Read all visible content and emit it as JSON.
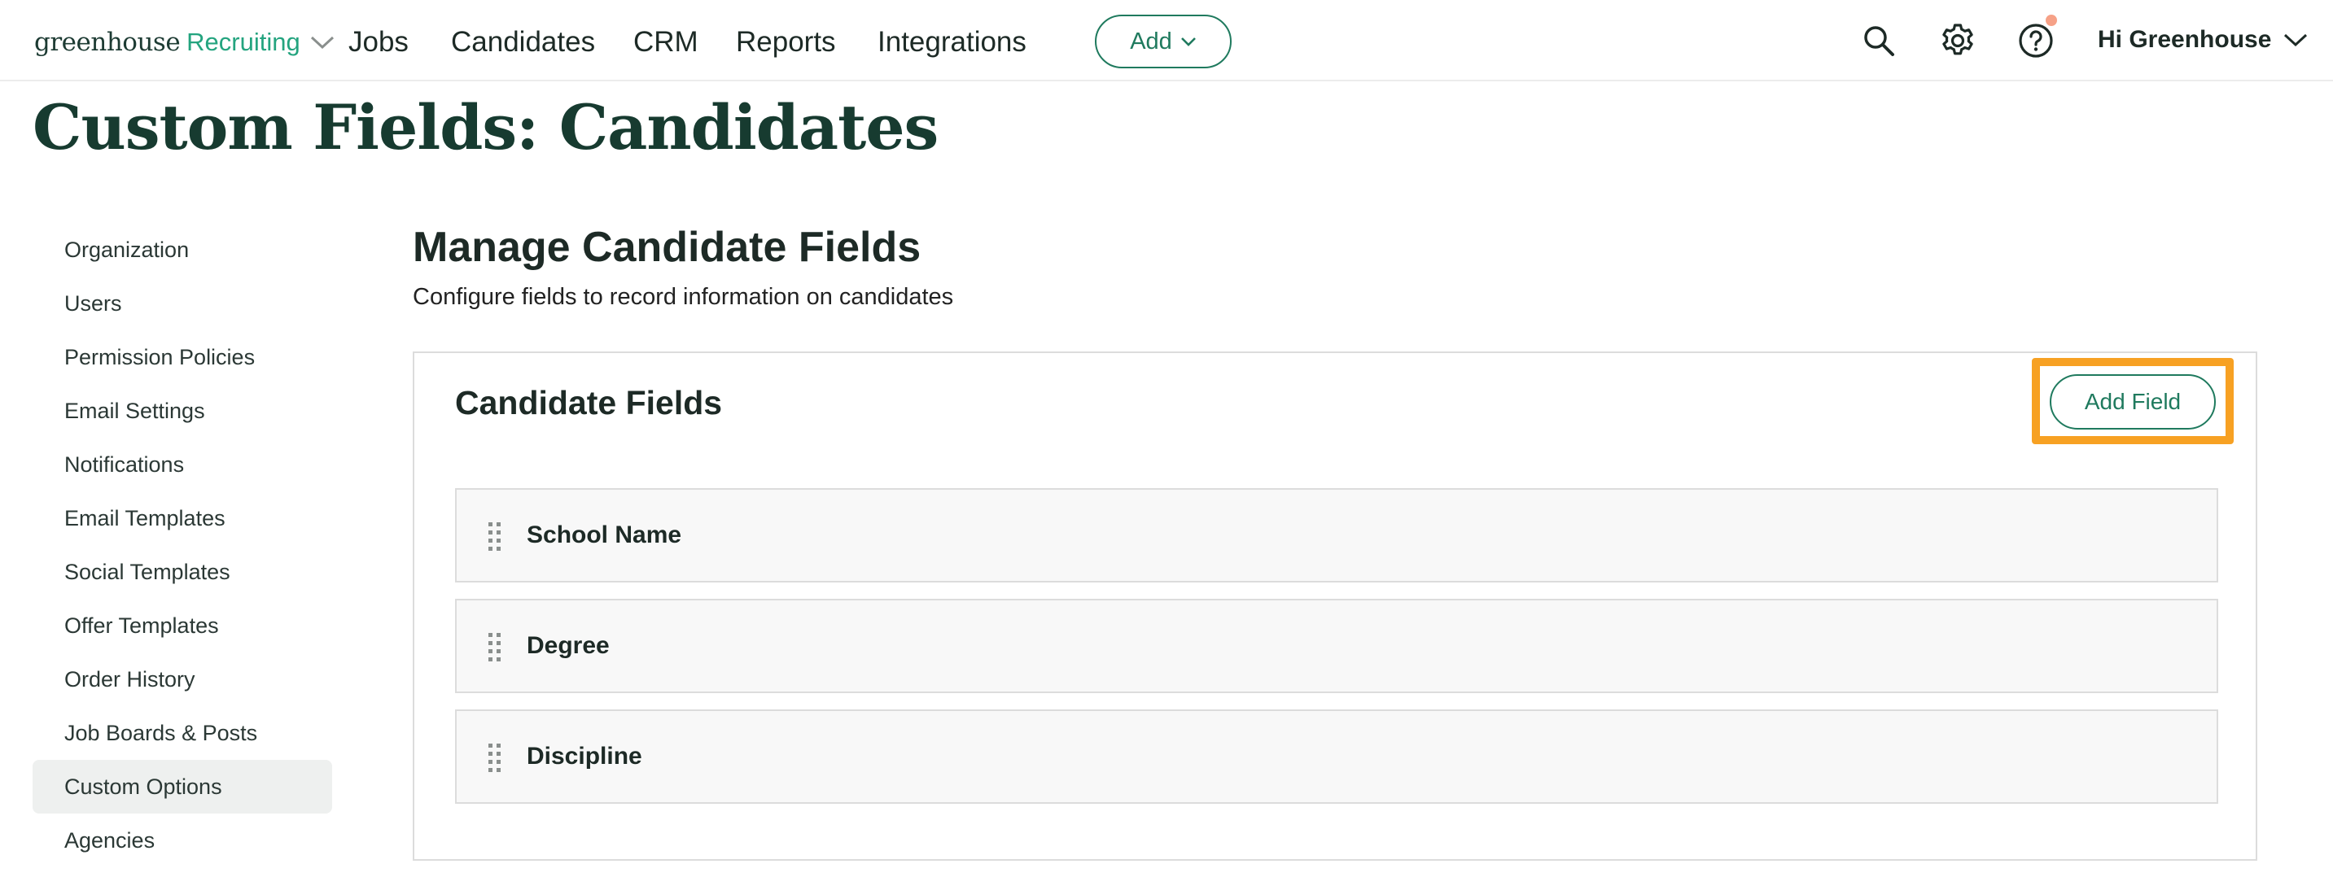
{
  "nav": {
    "logo_main": "greenhouse",
    "logo_sub": "Recruiting",
    "items": [
      "Jobs",
      "Candidates",
      "CRM",
      "Reports",
      "Integrations"
    ],
    "add_label": "Add",
    "icons": [
      "search-icon",
      "gear-icon",
      "help-icon"
    ],
    "user_label": "Hi Greenhouse"
  },
  "page": {
    "title": "Custom Fields: Candidates"
  },
  "sidebar": {
    "items": [
      {
        "label": "Organization"
      },
      {
        "label": "Users"
      },
      {
        "label": "Permission Policies"
      },
      {
        "label": "Email Settings"
      },
      {
        "label": "Notifications"
      },
      {
        "label": "Email Templates"
      },
      {
        "label": "Social Templates"
      },
      {
        "label": "Offer Templates"
      },
      {
        "label": "Order History"
      },
      {
        "label": "Job Boards & Posts"
      },
      {
        "label": "Custom Options",
        "active": true
      },
      {
        "label": "Agencies"
      }
    ]
  },
  "main": {
    "heading": "Manage Candidate Fields",
    "subheading": "Configure fields to record information on candidates",
    "panel": {
      "title": "Candidate Fields",
      "add_field_label": "Add Field",
      "fields": [
        {
          "label": "School Name"
        },
        {
          "label": "Degree"
        },
        {
          "label": "Discipline"
        }
      ]
    }
  },
  "colors": {
    "brand_green": "#1f7a5e",
    "logo_green": "#24a47f",
    "title_dark": "#173b30",
    "highlight_orange": "#f7a123",
    "notification_dot": "#f6a187"
  }
}
